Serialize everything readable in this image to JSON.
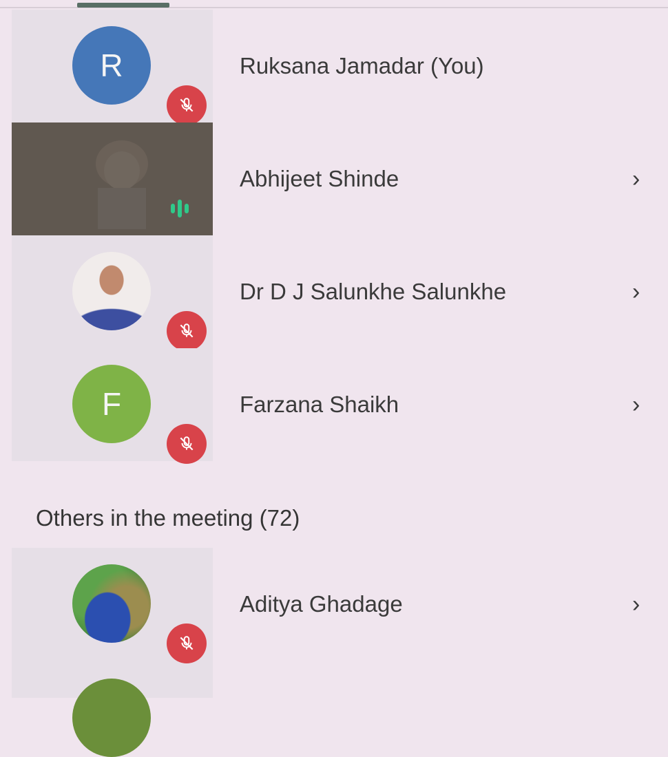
{
  "participants_top": [
    {
      "name": "Ruksana Jamadar (You)",
      "avatar_type": "initial",
      "initial": "R",
      "avatar_color": "#4577b8",
      "audio": "muted",
      "has_chevron": false
    },
    {
      "name": "Abhijeet Shinde",
      "avatar_type": "video",
      "audio": "speaking",
      "has_chevron": true
    },
    {
      "name": "Dr D J Salunkhe Salunkhe",
      "avatar_type": "photo",
      "audio": "muted",
      "has_chevron": true
    },
    {
      "name": "Farzana Shaikh",
      "avatar_type": "initial",
      "initial": "F",
      "avatar_color": "#7fb347",
      "audio": "muted",
      "has_chevron": true
    }
  ],
  "others_section": {
    "label": "Others in the meeting (72)"
  },
  "participants_others": [
    {
      "name": "Aditya Ghadage",
      "avatar_type": "photo",
      "audio": "muted",
      "has_chevron": true
    }
  ],
  "icons": {
    "mute": "mic-off-icon",
    "speaking": "speaking-indicator-icon",
    "chevron": "chevron-right-icon"
  },
  "colors": {
    "background": "#f0e5ee",
    "mute_badge": "#d8434a",
    "speaking_indicator": "#2fc98a"
  }
}
